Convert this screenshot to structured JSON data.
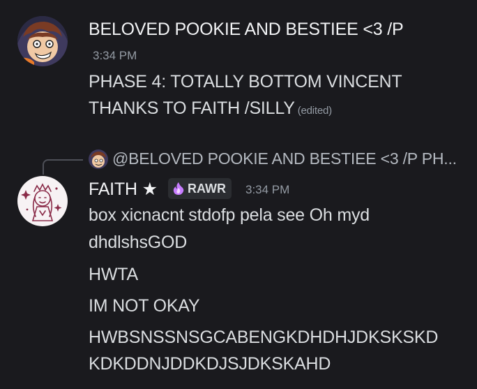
{
  "messages": [
    {
      "author": "BELOVED POOKIE AND BESTIEE <3 /P",
      "time": "3:34 PM",
      "lines": [
        "PHASE 4: TOTALLY BOTTOM VINCENT",
        "THANKS TO FAITH /SILLY"
      ],
      "edited": "(edited)"
    },
    {
      "reply_preview": "@BELOVED POOKIE AND BESTIEE <3 /P PH...",
      "author": "FAITH",
      "author_badge_glyph": "★",
      "tag": {
        "label": "RAWR",
        "icon": "purple-flame-icon"
      },
      "time": "3:34 PM",
      "lines": [
        "box xicnacnt stdofp pela see Oh myd",
        "dhdlshsGOD",
        "HWTA",
        "IM NOT OKAY",
        "HWBSNSSNSGCABENGKDHDHJDKSKSKD",
        "KDKDDNJDDKDJSJDKSKAHD"
      ]
    }
  ],
  "colors": {
    "background": "#1a1a1e",
    "text": "#dbdee1",
    "muted": "#949ba4",
    "tag_bg": "#2b2d31",
    "flame": "#c77dff"
  }
}
